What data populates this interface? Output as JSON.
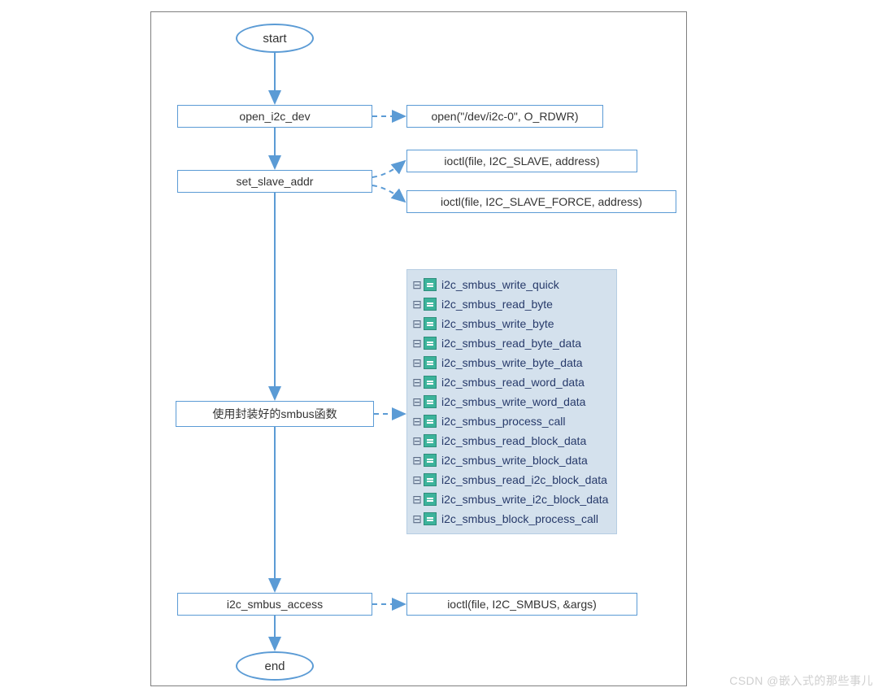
{
  "chart_data": {
    "type": "flowchart",
    "title": "",
    "nodes": [
      {
        "id": "start",
        "kind": "terminal",
        "label": "start"
      },
      {
        "id": "open",
        "kind": "process",
        "label": "open_i2c_dev"
      },
      {
        "id": "open_detail",
        "kind": "process",
        "label": "open(\"/dev/i2c-0\", O_RDWR)"
      },
      {
        "id": "setaddr",
        "kind": "process",
        "label": "set_slave_addr"
      },
      {
        "id": "ioctl_slave",
        "kind": "process",
        "label": "ioctl(file, I2C_SLAVE, address)"
      },
      {
        "id": "ioctl_slave_force",
        "kind": "process",
        "label": "ioctl(file, I2C_SLAVE_FORCE, address)"
      },
      {
        "id": "smbusfns",
        "kind": "process",
        "label": "使用封装好的smbus函数"
      },
      {
        "id": "fnlist",
        "kind": "list",
        "items": [
          "i2c_smbus_write_quick",
          "i2c_smbus_read_byte",
          "i2c_smbus_write_byte",
          "i2c_smbus_read_byte_data",
          "i2c_smbus_write_byte_data",
          "i2c_smbus_read_word_data",
          "i2c_smbus_write_word_data",
          "i2c_smbus_process_call",
          "i2c_smbus_read_block_data",
          "i2c_smbus_write_block_data",
          "i2c_smbus_read_i2c_block_data",
          "i2c_smbus_write_i2c_block_data",
          "i2c_smbus_block_process_call"
        ]
      },
      {
        "id": "access",
        "kind": "process",
        "label": "i2c_smbus_access"
      },
      {
        "id": "ioctl_smbus",
        "kind": "process",
        "label": "ioctl(file, I2C_SMBUS, &args)"
      },
      {
        "id": "end",
        "kind": "terminal",
        "label": "end"
      }
    ],
    "edges": [
      {
        "from": "start",
        "to": "open",
        "style": "solid"
      },
      {
        "from": "open",
        "to": "open_detail",
        "style": "dashed"
      },
      {
        "from": "open",
        "to": "setaddr",
        "style": "solid"
      },
      {
        "from": "setaddr",
        "to": "ioctl_slave",
        "style": "dashed"
      },
      {
        "from": "setaddr",
        "to": "ioctl_slave_force",
        "style": "dashed"
      },
      {
        "from": "setaddr",
        "to": "smbusfns",
        "style": "solid"
      },
      {
        "from": "smbusfns",
        "to": "fnlist",
        "style": "dashed"
      },
      {
        "from": "smbusfns",
        "to": "access",
        "style": "solid"
      },
      {
        "from": "access",
        "to": "ioctl_smbus",
        "style": "dashed"
      },
      {
        "from": "access",
        "to": "end",
        "style": "solid"
      }
    ]
  },
  "nodes": {
    "start": "start",
    "open": "open_i2c_dev",
    "open_detail": "open(\"/dev/i2c-0\", O_RDWR)",
    "setaddr": "set_slave_addr",
    "ioctl_slave": "ioctl(file, I2C_SLAVE, address)",
    "ioctl_slave_force": "ioctl(file, I2C_SLAVE_FORCE, address)",
    "smbusfns": "使用封装好的smbus函数",
    "access": "i2c_smbus_access",
    "ioctl_smbus": "ioctl(file, I2C_SMBUS, &args)",
    "end": "end"
  },
  "fnlist": [
    "i2c_smbus_write_quick",
    "i2c_smbus_read_byte",
    "i2c_smbus_write_byte",
    "i2c_smbus_read_byte_data",
    "i2c_smbus_write_byte_data",
    "i2c_smbus_read_word_data",
    "i2c_smbus_write_word_data",
    "i2c_smbus_process_call",
    "i2c_smbus_read_block_data",
    "i2c_smbus_write_block_data",
    "i2c_smbus_read_i2c_block_data",
    "i2c_smbus_write_i2c_block_data",
    "i2c_smbus_block_process_call"
  ],
  "watermark": "CSDN @嵌入式的那些事儿",
  "colors": {
    "stroke": "#5b9bd5",
    "listbg": "#d4e1ed",
    "listtext": "#273a6a"
  }
}
